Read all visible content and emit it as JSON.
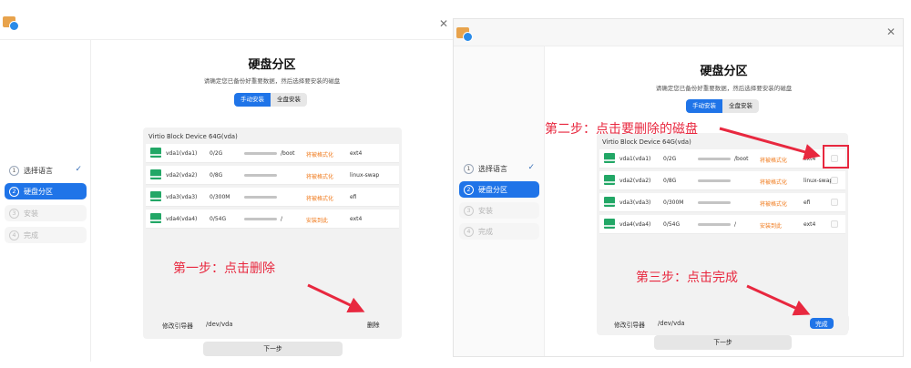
{
  "screen": {
    "title": "硬盘分区",
    "subtitle": "请确定您已备份好重要数据，然后选择要安装的磁盘",
    "modes": [
      "手动安装",
      "全盘安装"
    ],
    "steps": [
      {
        "num": "1",
        "label": "选择语言",
        "state": "done"
      },
      {
        "num": "2",
        "label": "硬盘分区",
        "state": "active"
      },
      {
        "num": "3",
        "label": "安装",
        "state": "disabled"
      },
      {
        "num": "4",
        "label": "完成",
        "state": "disabled"
      }
    ],
    "disk_name": "Virtio Block Device 64G(vda)",
    "bootloader_label": "修改引导器",
    "bootloader_value": "/dev/vda",
    "next_label": "下一步"
  },
  "left": {
    "partitions": [
      {
        "name": "vda1(vda1)",
        "size": "0/2G",
        "usage": 0.0,
        "mount": "/boot",
        "status": "将被格式化",
        "fs": "ext4"
      },
      {
        "name": "vda2(vda2)",
        "size": "0/8G",
        "usage": 0.0,
        "mount": "",
        "status": "将被格式化",
        "fs": "linux-swap"
      },
      {
        "name": "vda3(vda3)",
        "size": "0/300M",
        "usage": 0.0,
        "mount": "",
        "status": "将被格式化",
        "fs": "efi"
      },
      {
        "name": "vda4(vda4)",
        "size": "0/54G",
        "usage": 0.0,
        "mount": "/",
        "status": "安装到此",
        "fs": "ext4"
      }
    ],
    "action_label": "删除",
    "annotation": "第一步：点击删除"
  },
  "right": {
    "partitions": [
      {
        "name": "vda1(vda1)",
        "size": "0/2G",
        "usage": 0.0,
        "mount": "/boot",
        "status": "将被格式化",
        "fs": "ext4"
      },
      {
        "name": "vda2(vda2)",
        "size": "0/8G",
        "usage": 0.0,
        "mount": "",
        "status": "将被格式化",
        "fs": "linux-swap"
      },
      {
        "name": "vda3(vda3)",
        "size": "0/300M",
        "usage": 0.0,
        "mount": "",
        "status": "将被格式化",
        "fs": "efi"
      },
      {
        "name": "vda4(vda4)",
        "size": "0/54G",
        "usage": 0.0,
        "mount": "/",
        "status": "安装到此",
        "fs": "ext4"
      }
    ],
    "action_label": "完成",
    "annotation_step2": "第二步：点击要删除的磁盘",
    "annotation_step3": "第三步：点击完成"
  },
  "colors": {
    "accent": "#1f74e8",
    "annotation": "#e8283f",
    "status": "#f07a1c",
    "partition_icon": "#22a766"
  },
  "icons": {
    "app": "installer-app-icon",
    "close": "close-icon",
    "check": "check-icon",
    "partition": "disk-partition-icon"
  }
}
